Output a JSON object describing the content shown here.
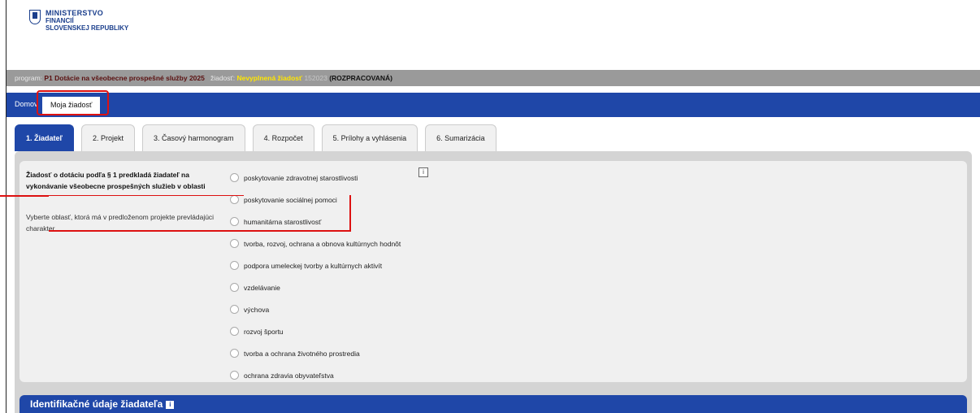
{
  "brand": {
    "line1": "MINISTERSTVO",
    "line2": "FINANCIÍ",
    "line3": "SLOVENSKEJ REPUBLIKY"
  },
  "status": {
    "program_label": "program:",
    "program_value": "P1 Dotácie na všeobecne prospešné služby 2025",
    "ziadost_label": "žiadosť:",
    "ziadost_value": "Nevyplnená žiadosť",
    "number": "152023",
    "state": "(ROZPRACOVANÁ)"
  },
  "nav": {
    "home": "Domov",
    "active": "Moja žiadosť"
  },
  "tabs": [
    "1. Žiadateľ",
    "2. Projekt",
    "3. Časový harmonogram",
    "4. Rozpočet",
    "5. Prílohy a vyhlásenia",
    "6. Sumarizácia"
  ],
  "question": {
    "title": "Žiadosť o dotáciu podľa § 1 predkladá žiadateľ na vykonávanie všeobecne prospešných služieb v oblasti",
    "subtitle": "Vyberte oblasť, ktorá má v predloženom projekte prevládajúci charakter"
  },
  "options": [
    "poskytovanie zdravotnej starostlivosti",
    "poskytovanie sociálnej pomoci",
    "humanitárna starostlivosť",
    "tvorba, rozvoj, ochrana a obnova kultúrnych hodnôt",
    "podpora umeleckej tvorby a kultúrnych aktivít",
    "vzdelávanie",
    "výchova",
    "rozvoj športu",
    "tvorba a ochrana životného prostredia",
    "ochrana zdravia obyvateľstva"
  ],
  "info_icon": "info-icon",
  "section": {
    "title": "Identifikačné údaje žiadateľa",
    "icon": "info-icon"
  },
  "colors": {
    "nav_blue": "#1f47a8",
    "status_gray": "#9a9a9a",
    "highlight_red": "#dd1111"
  }
}
